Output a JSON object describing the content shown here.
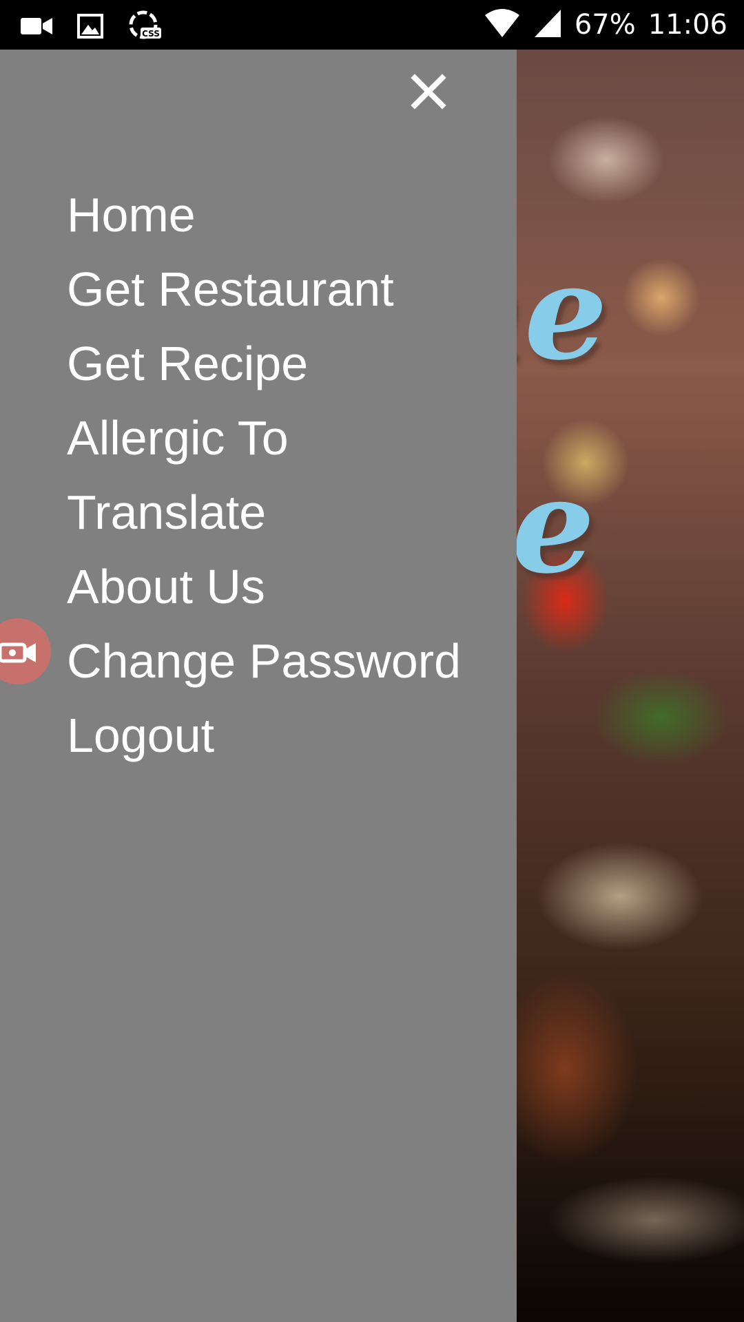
{
  "status_bar": {
    "battery": "67%",
    "time": "11:06",
    "icons": [
      "video-icon",
      "image-icon",
      "css-icon",
      "wifi-icon",
      "signal-icon"
    ],
    "css_badge": "CSS"
  },
  "background": {
    "title_fragments": [
      "me",
      "ive"
    ],
    "title_color": "#87cdea"
  },
  "drawer": {
    "background": "#808080",
    "close_icon": "close-icon",
    "items": [
      {
        "label": "Home"
      },
      {
        "label": "Get Restaurant"
      },
      {
        "label": "Get Recipe"
      },
      {
        "label": "Allergic To"
      },
      {
        "label": "Translate"
      },
      {
        "label": "About Us"
      },
      {
        "label": "Change Password"
      },
      {
        "label": "Logout"
      }
    ]
  },
  "floating_button": {
    "icon": "video-camera-icon",
    "color": "#d26e69"
  }
}
